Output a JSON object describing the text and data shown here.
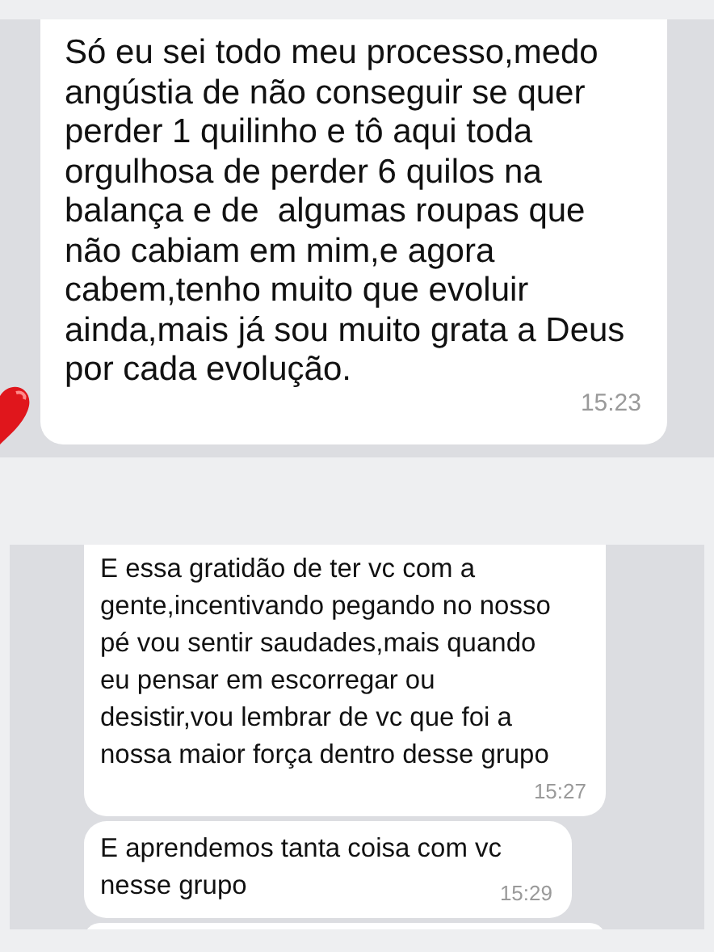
{
  "panels": [
    {
      "reaction": true,
      "more_below": false,
      "messages": [
        {
          "lines": [
            "Só eu sei todo meu processo,medo",
            "angústia de não conseguir se quer",
            "perder 1 quilinho e tô aqui toda",
            "orgulhosa de perder 6 quilos na",
            "balança e de  algumas roupas que",
            "não cabiam em mim,e agora",
            "cabem,tenho muito que evoluir",
            "ainda,mais já sou muito grata a Deus",
            "por cada evolução."
          ],
          "time": "15:23"
        }
      ]
    },
    {
      "reaction": false,
      "more_below": true,
      "messages": [
        {
          "lines": [
            "E essa gratidão de ter vc com a",
            "gente,incentivando pegando no nosso",
            "pé vou sentir saudades,mais quando",
            "eu pensar em escorregar ou",
            "desistir,vou lembrar de vc que foi a",
            "nossa maior força dentro desse grupo"
          ],
          "time": "15:27"
        },
        {
          "lines": [
            "E aprendemos tanta coisa com vc",
            "nesse grupo"
          ],
          "time": "15:29"
        }
      ]
    }
  ]
}
